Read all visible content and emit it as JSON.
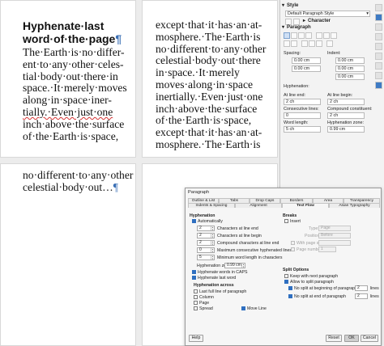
{
  "document": {
    "page1_heading": [
      "Hyphenate·last",
      "word·of·the·page"
    ],
    "page1_lines": [
      "The·Earth·is·no·differ-",
      "ent·to·any·other·celes-",
      "tial·body·out·there·in",
      "space.·It·merely·moves",
      "along·in·space·iner-",
      "tially.·Even·just·one",
      "inch·above·the·surface",
      "of·the·Earth·is·space,"
    ],
    "page2_lines": [
      "except·that·it·has·an·at-",
      "mosphere.·The·Earth·is",
      "no·different·to·any·other",
      "celestial·body·out·there",
      "in·space.·It·merely",
      "moves·along·in·space",
      "inertially.·Even·just·one",
      "inch·above·the·surface",
      "of·the·Earth·is·space,",
      "except·that·it·has·an·at-",
      "mosphere.·The·Earth·is"
    ],
    "page3_lines": [
      "no·different·to·any·other",
      "celestial·body·out…"
    ],
    "pilcrow": "¶"
  },
  "sidebar": {
    "style_section": "Style",
    "style_value": "Default Paragraph Style",
    "character_section": "Character",
    "paragraph_section": "Paragraph",
    "spacing_label": "Spacing:",
    "indent_label": "Indent:",
    "spacing_above": "0.00 cm",
    "spacing_below": "0.00 cm",
    "indent_before": "0.00 cm",
    "indent_after": "0.00 cm",
    "indent_first": "0.00 cm",
    "hyphenation_label": "Hyphenation:",
    "at_line_end_label": "At line end:",
    "at_line_end": "2 ch",
    "at_line_begin_label": "At line begin:",
    "at_line_begin": "2 ch",
    "consecutive_label": "Consecutive lines:",
    "consecutive": "0",
    "compound_label": "Compound constituent:",
    "compound": "2 ch",
    "word_length_label": "Word length:",
    "word_length": "5 ch",
    "zone_label": "Hyphenation zone:",
    "zone": "0.99 cm"
  },
  "dialog": {
    "title": "Paragraph",
    "tabs_row1": [
      "Outline & List",
      "Tabs",
      "Drop Caps",
      "Borders",
      "Area",
      "Transparency"
    ],
    "tabs_row2": [
      "Indents & Spacing",
      "Alignment",
      "Text Flow",
      "Asian Typography"
    ],
    "active_tab": "Text Flow",
    "hyphenation_header": "Hyphenation",
    "automatically": "Automatically",
    "rows": [
      {
        "value": "2",
        "label": "Characters at line end"
      },
      {
        "value": "2",
        "label": "Characters at line begin"
      },
      {
        "value": "2",
        "label": "Compound characters at line end"
      },
      {
        "value": "0",
        "label": "Maximum consecutive hyphenated lines"
      },
      {
        "value": "5",
        "label": "Minimum word length in characters"
      }
    ],
    "zone_label": "Hyphenation zone:",
    "zone_value": "0.99 cm",
    "hyph_caps": "Hyphenate words in CAPS",
    "hyph_last": "Hyphenate last word",
    "across_header": "Hyphenation across",
    "last_full": "Last full line of paragraph",
    "column": "Column",
    "page": "Page",
    "spread": "Spread",
    "move_line": "Move Line",
    "breaks_header": "Breaks",
    "insert": "Insert",
    "type_label": "Type:",
    "type_value": "Page",
    "position_label": "Position:",
    "position_value": "Before",
    "with_page_style": "With page style:",
    "page_number": "Page number:",
    "page_number_value": "1",
    "split_header": "Split Options",
    "keep_next": "Keep with next paragraph",
    "allow_split": "Allow to split paragraph",
    "no_split_begin": "No split at beginning of paragraph",
    "no_split_end": "No split at end of paragraph",
    "begin_value": "2",
    "end_value": "2",
    "lines": "lines",
    "help": "Help",
    "reset": "Reset",
    "ok": "OK",
    "cancel": "Cancel"
  }
}
